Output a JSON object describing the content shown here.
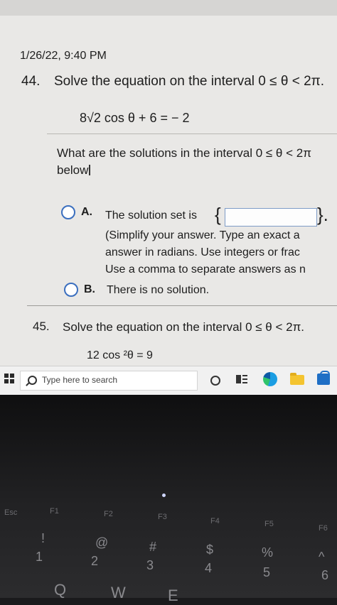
{
  "timestamp": "1/26/22, 9:40 PM",
  "q44": {
    "number": "44.",
    "text": "Solve the equation on the interval 0 ≤ θ < 2π.",
    "equation": "8√2 cos θ + 6 = − 2",
    "prompt_line1": "What are the solutions in the interval 0 ≤ θ < 2π",
    "prompt_line2": "below",
    "option_a": {
      "letter": "A.",
      "lead": "The solution set is",
      "brace_open": "{",
      "brace_close": "}.",
      "answer_value": "",
      "hint_line1": "(Simplify your answer. Type an exact a",
      "hint_line2": "answer in radians. Use integers or frac",
      "hint_line3": "Use a comma to separate answers as n"
    },
    "option_b": {
      "letter": "B.",
      "text": "There is no solution."
    }
  },
  "q45": {
    "number": "45.",
    "text": "Solve the equation on the interval 0 ≤ θ < 2π.",
    "equation": "12 cos ²θ = 9"
  },
  "taskbar": {
    "search_placeholder": "Type here to search"
  },
  "keyboard": {
    "keys": [
      "Esc",
      "F1",
      "F2",
      "F3",
      "F4",
      "F5",
      "F6"
    ],
    "num_row": [
      "!",
      "1",
      "@",
      "2",
      "#",
      "3",
      "$",
      "4",
      "%",
      "5",
      "^",
      "6"
    ],
    "letters": [
      "Q",
      "W",
      "E"
    ]
  },
  "colors": {
    "accent": "#3b6fbf",
    "screen_bg": "#e9e8e6"
  }
}
